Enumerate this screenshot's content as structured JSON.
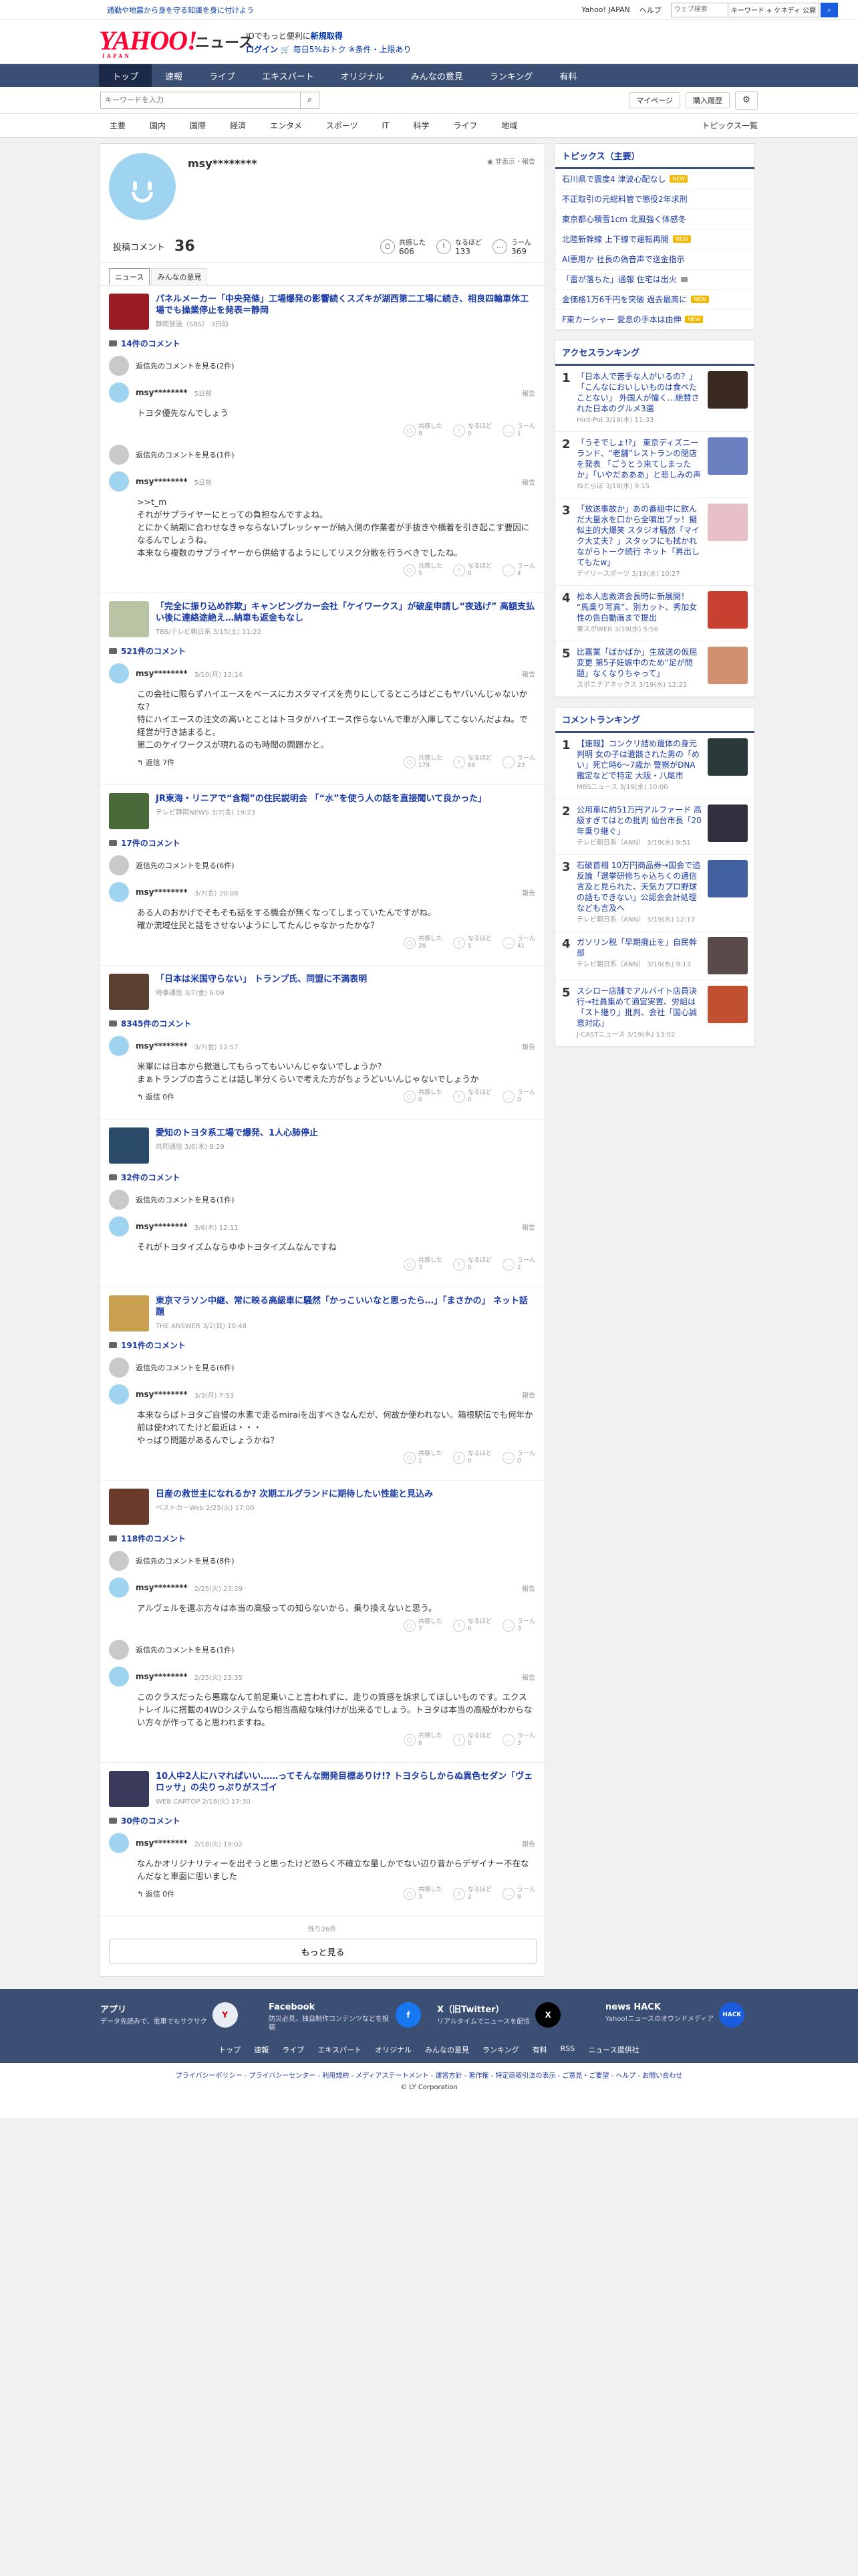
{
  "topbar": {
    "promo": "通勤や地震から身を守る知識を身に付けよう",
    "links": [
      "Yahoo! JAPAN",
      "ヘルプ"
    ],
    "search_placeholder": "ウェブ検索",
    "keyword": "キーワード + ケネディ 公開"
  },
  "brand": {
    "logo": "YAHOO!",
    "logo_sub": "JAPAN",
    "service": "ニュース",
    "info1": "IDでもっと便利に",
    "info1_link": "新規取得",
    "info2_login": "ログイン",
    "info2_rest": "毎日5%おトク ※条件・上限あり"
  },
  "gnav": [
    "トップ",
    "速報",
    "ライブ",
    "エキスパート",
    "オリジナル",
    "みんなの意見",
    "ランキング",
    "有料"
  ],
  "search": {
    "placeholder": "キーワードを入力",
    "mypage": "マイページ",
    "history": "購入履歴"
  },
  "catnav": {
    "items": [
      "主要",
      "国内",
      "国際",
      "経済",
      "エンタメ",
      "スポーツ",
      "IT",
      "科学",
      "ライフ",
      "地域"
    ],
    "topics_list": "トピックス一覧"
  },
  "profile": {
    "name": "msy********",
    "notice": "非表示・報告",
    "comments_label": "投稿コメント",
    "comments_count": "36",
    "reactions": [
      {
        "label": "共感した",
        "count": "606",
        "icon": "○"
      },
      {
        "label": "なるほど",
        "count": "133",
        "icon": "!"
      },
      {
        "label": "うーん",
        "count": "369",
        "icon": "…"
      }
    ],
    "tabs": [
      "ニュース",
      "みんなの意見"
    ]
  },
  "labels": {
    "show_reply": "返信先のコメントを見る",
    "reply": "返信",
    "report": "報告",
    "agree": "共感した",
    "hmm": "なるほど",
    "un": "うーん"
  },
  "items": [
    {
      "title": "パネルメーカー「中央発條」工場爆発の影響続くスズキが湖西第二工場に続き、相良四輪車体工場でも操業停止を発表＝静岡",
      "source": "静岡放送（SBS） 3日前",
      "thumb": "#9a1c24",
      "count": "14件のコメント",
      "comments": [
        {
          "show": "返信先のコメントを見る(2件)",
          "time": "5日前",
          "body": "トヨタ優先なんでしょう",
          "reply": "",
          "r": [
            "8",
            "0",
            "1"
          ]
        },
        {
          "show": "返信先のコメントを見る(1件)",
          "time": "5日前",
          "body": ">>t_m\nそれがサプライヤーにとっての負担なんですよね。\nとにかく納期に合わせなきゃならないプレッシャーが納入側の作業者が手抜きや横着を引き起こす要因になるんでしょうね。\n本来なら複数のサプライヤーから供給するようにしてリスク分散を行うべきでしたね。",
          "reply": "",
          "r": [
            "5",
            "0",
            "4"
          ]
        }
      ]
    },
    {
      "title": "「完全に振り込め詐欺」キャンピングカー会社「ケイワークス」が破産申請し“夜逃げ” 高額支払い後に連絡途絶え…納車も返金もなし",
      "source": "TBS/テレビ朝日系 3/15(土) 11:22",
      "thumb": "#b8c4a4",
      "count": "521件のコメント",
      "comments": [
        {
          "show": "",
          "time": "3/10(月) 12:14",
          "body": "この会社に限らずハイエースをベースにカスタマイズを売りにしてるところはどこもヤバいんじゃないかな？\n特にハイエースの注文の高いとことはトヨタがハイエース作らないんで車が入庫してこないんだよね。で経営が行き詰まると。\n第二のケイワークスが現れるのも時間の問題かと。",
          "reply": "返信 7件",
          "r": [
            "179",
            "66",
            "23"
          ]
        }
      ]
    },
    {
      "title": "JR東海・リニアで“含糊”の住民説明会 「“水”を使う人の話を直接聞いて良かった」",
      "source": "テレビ静岡NEWS 3/7(金) 19:23",
      "thumb": "#4a6a3a",
      "count": "17件のコメント",
      "comments": [
        {
          "show": "返信先のコメントを見る(6件)",
          "time": "3/7(金) 20:08",
          "body": "ある人のおかげでそもそも話をする機会が無くなってしまっていたんですがね。\n確か流域住民と話をさせないようにしてたんじゃなかったかな？",
          "reply": "",
          "r": [
            "28",
            "5",
            "41"
          ]
        }
      ]
    },
    {
      "title": "「日本は米国守らない」 トランプ氏、同盟に不満表明",
      "source": "時事通信 3/7(金) 6:09",
      "thumb": "#5a4030",
      "count": "8345件のコメント",
      "comments": [
        {
          "show": "",
          "time": "3/7(金) 12:57",
          "body": "米軍には日本から撤退してもらってもいいんじゃないでしょうか？\nまぁトランプの言うことは話し半分くらいで考えた方がちょうどいいんじゃないでしょうか",
          "reply": "返信 0件",
          "r": [
            "0",
            "0",
            "0"
          ]
        }
      ]
    },
    {
      "title": "愛知のトヨタ系工場で爆発、1人心肺停止",
      "source": "共同通信 3/6(木) 9:29",
      "thumb": "#2a4a6a",
      "count": "32件のコメント",
      "comments": [
        {
          "show": "返信先のコメントを見る(1件)",
          "time": "3/6(木) 12:11",
          "body": "それがトヨタイズムならゆゆトヨタイズムなんですね",
          "reply": "",
          "r": [
            "3",
            "0",
            "2"
          ]
        }
      ]
    },
    {
      "title": "東京マラソン中継、常に映る高級車に騒然「かっこいいなと思ったら…」「まさかの」 ネット話題",
      "source": "THE ANSWER 3/2(日) 10:48",
      "thumb": "#c8a050",
      "count": "191件のコメント",
      "comments": [
        {
          "show": "返信先のコメントを見る(6件)",
          "time": "3/3(月) 7:53",
          "body": "本来ならばトヨタご自慢の水素で走るmiraiを出すべきなんだが、何故か使われない。箱根駅伝でも何年か前は使われてたけど最近は・・・\nやっぱり問題があるんでしょうかね？",
          "reply": "",
          "r": [
            "1",
            "0",
            "0"
          ]
        }
      ]
    },
    {
      "title": "日産の救世主になれるか? 次期エルグランドに期待したい性能と見込み",
      "source": "ベストカーWeb 2/25(火) 17:00",
      "thumb": "#6a3a2a",
      "count": "118件のコメント",
      "comments": [
        {
          "show": "返信先のコメントを見る(8件)",
          "time": "2/25(火) 23:39",
          "body": "アルヴェルを選ぶ方々は本当の高級っての知らないから、乗り換えないと思う。",
          "reply": "",
          "r": [
            "7",
            "0",
            "3"
          ]
        },
        {
          "show": "返信先のコメントを見る(1件)",
          "time": "2/25(火) 23:35",
          "body": "このクラスだったら悪霧なんて前足乗いこと言われずに、走りの質感を訴求してほしいものです。エクストレイルに搭載の4WDシステムなら相当高級な味付けが出来るでしょう。トヨタは本当の高級がわからない方々が作ってると思われますね。",
          "reply": "",
          "r": [
            "6",
            "0",
            "3"
          ]
        }
      ]
    },
    {
      "title": "10人中2人にハマればいい……ってそんな開発目標ありけ!? トヨタらしからぬ異色セダン「ヴェロッサ」の尖りっぷりがスゴイ",
      "source": "WEB CARTOP 2/18(火) 17:30",
      "thumb": "#3a3a5a",
      "count": "30件のコメント",
      "comments": [
        {
          "show": "",
          "time": "2/18(火) 19:02",
          "body": "なんかオリジナリティーを出そうと思ったけど恐らく不確立な量しかでない辺り昔からデザイナー不在なんだなと車面に思いました",
          "reply": "返信 0件",
          "r": [
            "3",
            "2",
            "8"
          ]
        }
      ]
    }
  ],
  "more": {
    "remaining": "残り26件",
    "button": "もっと見る"
  },
  "side": {
    "topics_head": "トピックス（主要）",
    "topics": [
      {
        "t": "石川県で震度4 津波心配なし",
        "b": "new"
      },
      {
        "t": "不正取引の元総料管で懲役2年求刑",
        "b": ""
      },
      {
        "t": "東京都心積雪1cm 北風強く体感冬",
        "b": ""
      },
      {
        "t": "北陸新幹線 上下線で運転再開",
        "b": "new"
      },
      {
        "t": "AI悪用か 社長の偽音声で送金指示",
        "b": ""
      },
      {
        "t": "「雷が落ちた」通報 住宅は出火",
        "b": "cam"
      },
      {
        "t": "金価格1万6千円を突破 過去最高に",
        "b": "new"
      },
      {
        "t": "F東カーシャー 愛息の手本は由伸",
        "b": "new"
      }
    ],
    "access_head": "アクセスランキング",
    "access": [
      {
        "t": "「日本人で苦手な人がいるの？」「こんなにおいしいものは食べたことない」 外国人が憧く…絶賛された日本のグルメ3選",
        "s": "Hint-Pot 3/19(水) 11:33",
        "c": "#3a2a20"
      },
      {
        "t": "「うそでしょ!?」 東京ディズニーランド、“老舗”レストランの閉店を発表 「ごうとう来てしまったか」「いやだあああ」と悲しみの声",
        "s": "ねとらぼ 3/19(水) 9:15",
        "c": "#6a80c0"
      },
      {
        "t": "「放送事故か」あの番組中に飲んだ大量水を口から全噴出ブッ！擬似主的大爆笑 スタジオ騒然「マイク大丈夫？」スタッフにも拭かれながらトーク続行 ネット「昇出してもたw」",
        "s": "デイリースポーツ 3/19(水) 10:27",
        "c": "#e8c0c8"
      },
      {
        "t": "松本人志救済会長時に新展開！ “馬乗り写真”、別カット、秀加女性の告白動画まで提出",
        "s": "東スポWEB 3/19(水) 5:56",
        "c": "#c84030"
      },
      {
        "t": "比嘉業「ばかばか」生放送の仮屈変更 第5子妊娠中のため“足が問題」なくなりちゃって」",
        "s": "スポニチアネックス 3/19(水) 12:23",
        "c": "#d09070"
      }
    ],
    "comment_head": "コメントランキング",
    "crank": [
      {
        "t": "【速報】コンクリ詰め遺体の身元判明 女の子は遺骸された男の「めい」死亡時6～7歳か 警察がDNA鑑定などで特定 大阪・八尾市",
        "s": "MBSニュース 3/19(水) 10:00",
        "c": "#2a3a3a"
      },
      {
        "t": "公用車に約51万円アルファード 高級すぎてはとの批判 仙台市長「20年乗り継ぐ」",
        "s": "テレビ朝日系（ANN） 3/19(水) 9:51",
        "c": "#303040"
      },
      {
        "t": "石破首相 10万円商品券→国会で追反論「選挙研修ちゃ込ちくの通信言及と見られた、天気カプロ野球の話もできない」公認会会計処理なども言及へ",
        "s": "テレビ朝日系（ANN） 3/19(水) 12:17",
        "c": "#4060a0"
      },
      {
        "t": "ガソリン税「早期廃止を」自民幹部",
        "s": "テレビ朝日系（ANN） 3/19(水) 9:13",
        "c": "#5a4a4a"
      },
      {
        "t": "スシロー店舗でアルバイト店員決行→社員集めて適宜実置、労組は「スト継り」批判、会社「国心誠意対応」",
        "s": "J-CASTニュース 3/19(水) 13:02",
        "c": "#c05030"
      }
    ]
  },
  "footer": {
    "apps": [
      {
        "t": "アプリ",
        "d": "データ先読みで、電車でもサクサク",
        "icon": "Y",
        "bg": "#e8ecf4",
        "fg": "#c00"
      },
      {
        "t": "Facebook",
        "d": "防災必見、独自制作コンテンツなどを投稿",
        "icon": "f",
        "bg": "#1877f2",
        "fg": "#fff"
      },
      {
        "t": "X（旧Twitter）",
        "d": "リアルタイムでニュースを配信",
        "icon": "X",
        "bg": "#000",
        "fg": "#fff"
      },
      {
        "t": "news HACK",
        "d": "Yahoo!ニュースのオウンドメディア",
        "icon": "HACK",
        "bg": "#1a5ce0",
        "fg": "#fff"
      }
    ],
    "links": [
      "トップ",
      "速報",
      "ライブ",
      "エキスパート",
      "オリジナル",
      "みんなの意見",
      "ランキング",
      "有料",
      "RSS",
      "ニュース提供社"
    ],
    "legal": "プライバシーポリシー - プライバシーセンター - 利用規約 - メディアステートメント - 運営方針 - 著作権 - 特定商取引法の表示 - ご意見・ご要望 - ヘルプ - お問い合わせ",
    "copyright": "© LY Corporation"
  }
}
